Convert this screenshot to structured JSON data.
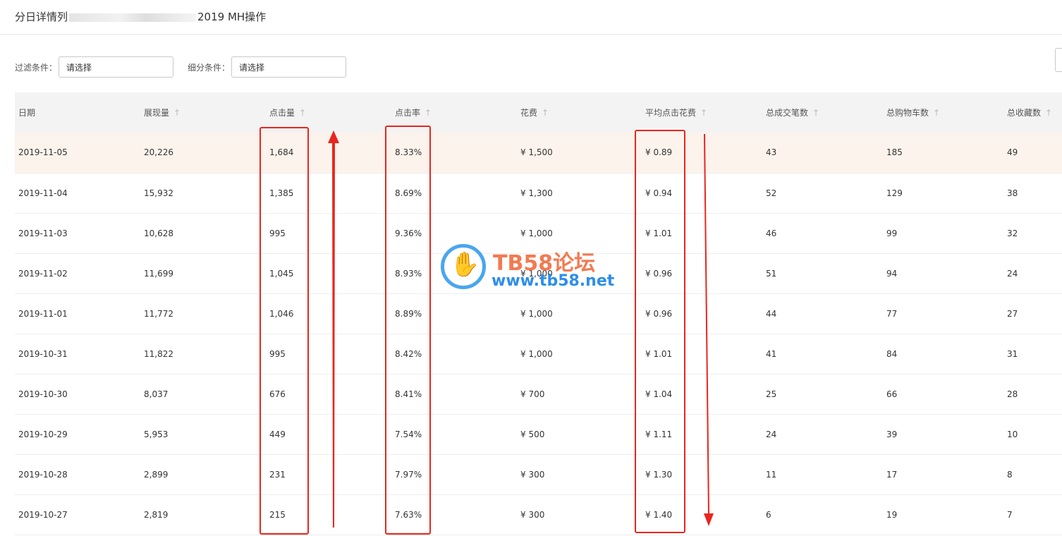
{
  "header": {
    "title_prefix": "分日详情列",
    "title_suffix": "2019 MH操作"
  },
  "filters": [
    {
      "label": "过滤条件：",
      "value": "请选择"
    },
    {
      "label": "细分条件：",
      "value": "请选择"
    }
  ],
  "table": {
    "columns": [
      "日期",
      "展现量",
      "点击量",
      "点击率",
      "花费",
      "平均点击花费",
      "总成交笔数",
      "总购物车数",
      "总收藏数"
    ],
    "sort_icon": "↑",
    "rows": [
      [
        "2019-11-05",
        "20,226",
        "1,684",
        "8.33%",
        "¥ 1,500",
        "¥ 0.89",
        "43",
        "185",
        "49"
      ],
      [
        "2019-11-04",
        "15,932",
        "1,385",
        "8.69%",
        "¥ 1,300",
        "¥ 0.94",
        "52",
        "129",
        "38"
      ],
      [
        "2019-11-03",
        "10,628",
        "995",
        "9.36%",
        "¥ 1,000",
        "¥ 1.01",
        "46",
        "99",
        "32"
      ],
      [
        "2019-11-02",
        "11,699",
        "1,045",
        "8.93%",
        "¥ 1,000",
        "¥ 0.96",
        "51",
        "94",
        "24"
      ],
      [
        "2019-11-01",
        "11,772",
        "1,046",
        "8.89%",
        "¥ 1,000",
        "¥ 0.96",
        "44",
        "77",
        "27"
      ],
      [
        "2019-10-31",
        "11,822",
        "995",
        "8.42%",
        "¥ 1,000",
        "¥ 1.01",
        "41",
        "84",
        "31"
      ],
      [
        "2019-10-30",
        "8,037",
        "676",
        "8.41%",
        "¥ 700",
        "¥ 1.04",
        "25",
        "66",
        "28"
      ],
      [
        "2019-10-29",
        "5,953",
        "449",
        "7.54%",
        "¥ 500",
        "¥ 1.11",
        "24",
        "39",
        "10"
      ],
      [
        "2019-10-28",
        "2,899",
        "231",
        "7.97%",
        "¥ 300",
        "¥ 1.30",
        "11",
        "17",
        "8"
      ],
      [
        "2019-10-27",
        "2,819",
        "215",
        "7.63%",
        "¥ 300",
        "¥ 1.40",
        "6",
        "19",
        "7"
      ]
    ]
  },
  "watermark": {
    "brand": "TB58论坛",
    "url": "www.tb58.net",
    "icon": "hand-icon"
  },
  "annotations": {
    "color": "#e8261e",
    "up_arrow_icon": "arrow-up-icon",
    "down_arrow_icon": "arrow-down-icon"
  },
  "colors": {
    "highlight_row": "#fcf3ec",
    "header_bg": "#f3f3f3"
  }
}
